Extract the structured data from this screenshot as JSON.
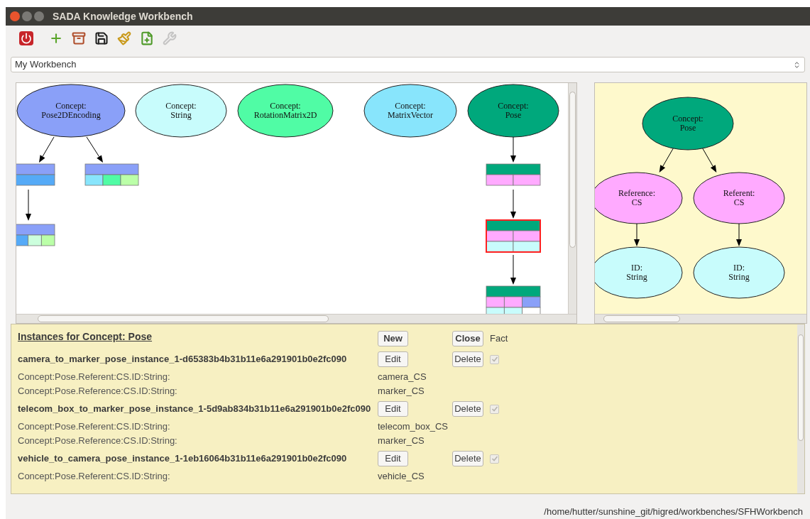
{
  "window": {
    "title": "SADA Knowledge Workbench"
  },
  "toolbar": {
    "buttons": [
      {
        "kind": "power",
        "disabled": false
      },
      {
        "kind": "add",
        "disabled": false
      },
      {
        "kind": "drawer",
        "disabled": false
      },
      {
        "kind": "save",
        "disabled": false
      },
      {
        "kind": "broom",
        "disabled": false
      },
      {
        "kind": "new-file",
        "disabled": false
      },
      {
        "kind": "tools",
        "disabled": true
      }
    ]
  },
  "workbench_select": {
    "value": "My Workbench"
  },
  "concept_graph": {
    "concepts": [
      {
        "lines": [
          "Concept:",
          "Pose2DEncoding"
        ],
        "color": "#8aa0f8"
      },
      {
        "lines": [
          "Concept:",
          "String"
        ],
        "color": "#c8fcfc"
      },
      {
        "lines": [
          "Concept:",
          "RotationMatrix2D"
        ],
        "color": "#50fca5"
      },
      {
        "lines": [
          "Concept:",
          "MatrixVector"
        ],
        "color": "#88e5fc"
      },
      {
        "lines": [
          "Concept:",
          "Pose"
        ],
        "color": "#00a87c"
      }
    ]
  },
  "detail_graph": {
    "root": {
      "lines": [
        "Concept:",
        "Pose"
      ],
      "color": "#00a87c",
      "children": [
        {
          "lines": [
            "Reference:",
            "CS"
          ],
          "color": "#ffaaff",
          "children": [
            {
              "lines": [
                "ID:",
                "String"
              ],
              "color": "#c8fcfc"
            }
          ]
        },
        {
          "lines": [
            "Referent:",
            "CS"
          ],
          "color": "#ffaaff",
          "children": [
            {
              "lines": [
                "ID:",
                "String"
              ],
              "color": "#c8fcfc"
            }
          ]
        }
      ]
    }
  },
  "instances_panel": {
    "title": "Instances for Concept: Pose",
    "new_button": "New",
    "close_button": "Close",
    "fact_label": "Fact",
    "instances": [
      {
        "name": "camera_to_marker_pose_instance_1-d65383b4b31b11e6a291901b0e2fc090",
        "edit": "Edit",
        "delete": "Delete",
        "fact": true,
        "fields": [
          {
            "label": "Concept:Pose.Referent:CS.ID:String:",
            "value": "camera_CS"
          },
          {
            "label": "Concept:Pose.Reference:CS.ID:String:",
            "value": "marker_CS"
          }
        ]
      },
      {
        "name": "telecom_box_to_marker_pose_instance_1-5d9ab834b31b11e6a291901b0e2fc090",
        "edit": "Edit",
        "delete": "Delete",
        "fact": true,
        "fields": [
          {
            "label": "Concept:Pose.Referent:CS.ID:String:",
            "value": "telecom_box_CS"
          },
          {
            "label": "Concept:Pose.Reference:CS.ID:String:",
            "value": "marker_CS"
          }
        ]
      },
      {
        "name": "vehicle_to_camera_pose_instance_1-1eb16064b31b11e6a291901b0e2fc090",
        "edit": "Edit",
        "delete": "Delete",
        "fact": true,
        "fields": [
          {
            "label": "Concept:Pose.Referent:CS.ID:String:",
            "value": "vehicle_CS"
          }
        ]
      }
    ]
  },
  "status_bar": {
    "path": "/home/hutter/sunshine_git/higred/workbenches/SFHWorkbench"
  }
}
